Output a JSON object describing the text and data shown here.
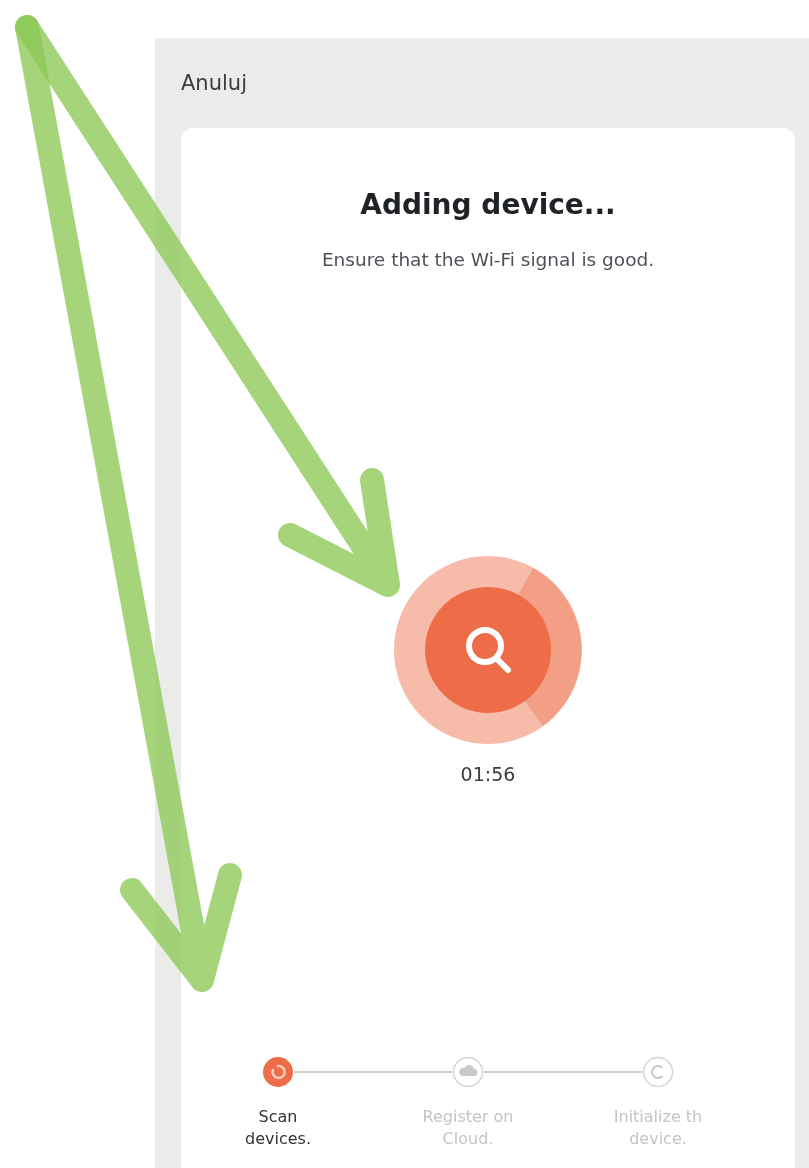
{
  "header": {
    "cancel_label": "Anuluj"
  },
  "card": {
    "title": "Adding device...",
    "subtitle": "Ensure that the Wi-Fi signal is good.",
    "timer": "01:56"
  },
  "steps": [
    {
      "label_lines": [
        "Scan",
        "devices."
      ],
      "selected": true
    },
    {
      "label_lines": [
        "Register on",
        "Cloud."
      ],
      "selected": false
    },
    {
      "label_lines": [
        "Initialize th",
        "device."
      ],
      "selected": false
    }
  ]
}
